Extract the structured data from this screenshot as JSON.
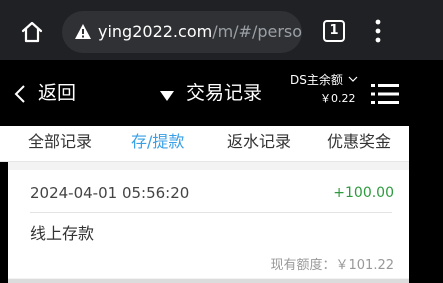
{
  "browser": {
    "url_host": "ying2022.com",
    "url_path": "/m/#/person",
    "tab_count": "1"
  },
  "header": {
    "back_label": "返回",
    "title": "交易记录",
    "ds_label": "DS主余额",
    "ds_amount": "￥0.22"
  },
  "tabs": [
    {
      "label": "全部记录",
      "active": false
    },
    {
      "label": "存/提款",
      "active": true
    },
    {
      "label": "返水记录",
      "active": false
    },
    {
      "label": "优惠奖金",
      "active": false
    }
  ],
  "records": [
    {
      "time": "2024-04-01 05:56:20",
      "amount": "+100.00",
      "type": "线上存款",
      "balance": "现有额度：￥101.22"
    }
  ],
  "colors": {
    "active_tab": "#3aa0e6",
    "amount_positive": "#2e9a3e",
    "header_bg": "#000000",
    "browser_bg": "#202124"
  }
}
